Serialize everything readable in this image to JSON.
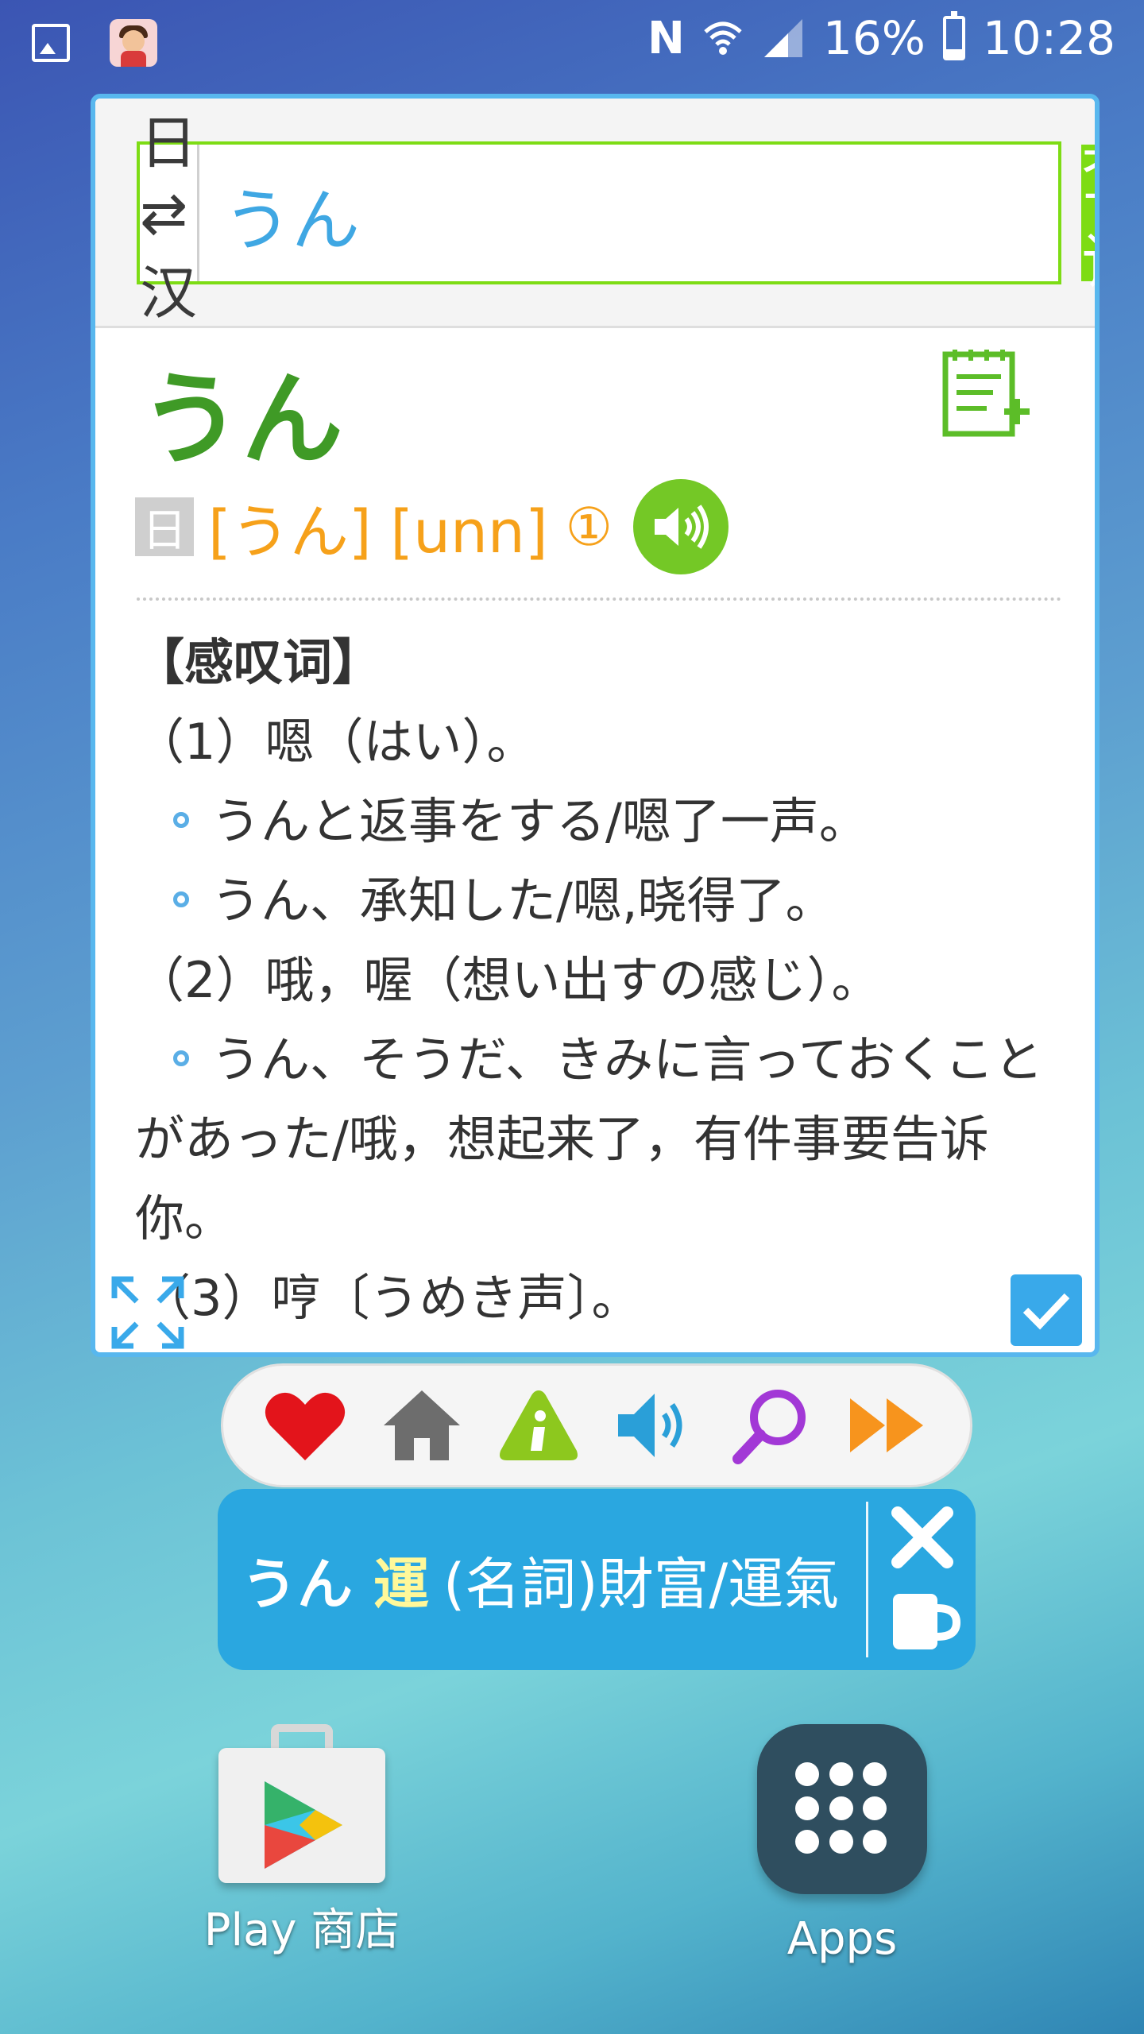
{
  "status_bar": {
    "network_glyph": "N",
    "battery_percent": "16%",
    "time": "10:28",
    "icons": [
      "gallery-icon",
      "jlpt-app-icon",
      "nfc-icon",
      "wifi-icon",
      "signal-icon",
      "battery-charging-icon"
    ]
  },
  "search": {
    "lang_toggle": "日⇄汉",
    "query": "うん",
    "button_label": "查词"
  },
  "entry": {
    "headword": "うん",
    "lang_badge": "日",
    "reading": "[うん] [unn]",
    "tone": "①",
    "pos": "【感叹词】",
    "lines": [
      {
        "type": "sense",
        "text": "（1）嗯（はい）。"
      },
      {
        "type": "example",
        "text": "うんと返事をする/嗯了一声。"
      },
      {
        "type": "example",
        "text": "うん、承知した/嗯,晓得了。"
      },
      {
        "type": "sense",
        "text": "（2）哦，喔（想い出すの感じ）。"
      },
      {
        "type": "example",
        "text": "うん、そうだ、きみに言っておくことがあった/哦，想起来了，有件事要告诉你。"
      },
      {
        "type": "sense",
        "text": "（3）哼〔うめき声〕。"
      }
    ]
  },
  "toolbar": {
    "buttons": [
      "heart-icon",
      "home-icon",
      "info-icon",
      "speaker-icon",
      "search-icon",
      "fast-forward-icon"
    ]
  },
  "bubble": {
    "word": "うん",
    "kanji": "運",
    "gloss": "(名詞)財富/運氣"
  },
  "home": {
    "play_label": "Play 商店",
    "apps_label": "Apps"
  },
  "colors": {
    "accent_green": "#7ddc14",
    "headword_green": "#3f9a26",
    "reading_orange": "#f6a11a",
    "panel_border": "#58b7ee",
    "bubble_blue": "#2aa7e0"
  }
}
